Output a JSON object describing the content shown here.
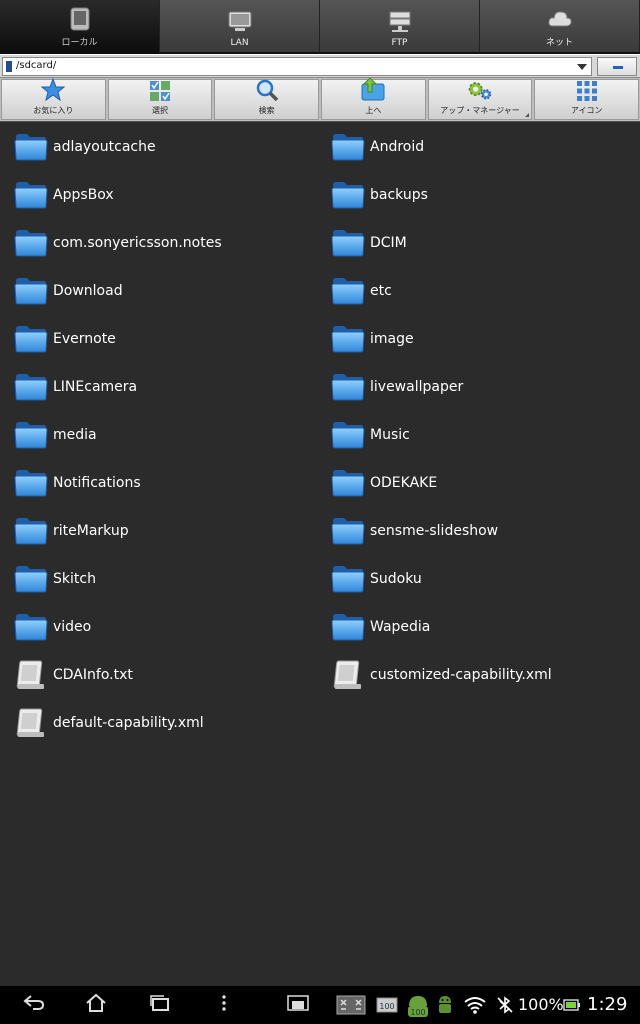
{
  "tabs": [
    {
      "label": "ローカル",
      "icon": "tablet-icon",
      "active": true
    },
    {
      "label": "LAN",
      "icon": "monitor-icon",
      "active": false
    },
    {
      "label": "FTP",
      "icon": "server-icon",
      "active": false
    },
    {
      "label": "ネット",
      "icon": "cloud-icon",
      "active": false
    }
  ],
  "path": {
    "value": "/sdcard/"
  },
  "toolbar": [
    {
      "label": "お気に入り",
      "icon": "star-icon"
    },
    {
      "label": "選択",
      "icon": "select-grid-icon"
    },
    {
      "label": "検索",
      "icon": "magnifier-icon"
    },
    {
      "label": "上へ",
      "icon": "up-folder-icon"
    },
    {
      "label": "アップ・マネージャー",
      "icon": "gears-icon"
    },
    {
      "label": "アイコン",
      "icon": "icon-grid-icon"
    }
  ],
  "files": [
    {
      "name": "adlayoutcache",
      "type": "folder"
    },
    {
      "name": "Android",
      "type": "folder"
    },
    {
      "name": "AppsBox",
      "type": "folder"
    },
    {
      "name": "backups",
      "type": "folder"
    },
    {
      "name": "com.sonyericsson.notes",
      "type": "folder"
    },
    {
      "name": "DCIM",
      "type": "folder"
    },
    {
      "name": "Download",
      "type": "folder"
    },
    {
      "name": "etc",
      "type": "folder"
    },
    {
      "name": "Evernote",
      "type": "folder"
    },
    {
      "name": "image",
      "type": "folder"
    },
    {
      "name": "LINEcamera",
      "type": "folder"
    },
    {
      "name": "livewallpaper",
      "type": "folder"
    },
    {
      "name": "media",
      "type": "folder"
    },
    {
      "name": "Music",
      "type": "folder"
    },
    {
      "name": "Notifications",
      "type": "folder"
    },
    {
      "name": "ODEKAKE",
      "type": "folder"
    },
    {
      "name": "riteMarkup",
      "type": "folder"
    },
    {
      "name": "sensme-slideshow",
      "type": "folder"
    },
    {
      "name": "Skitch",
      "type": "folder"
    },
    {
      "name": "Sudoku",
      "type": "folder"
    },
    {
      "name": "video",
      "type": "folder"
    },
    {
      "name": "Wapedia",
      "type": "folder"
    },
    {
      "name": "CDAInfo.txt",
      "type": "file"
    },
    {
      "name": "customized-capability.xml",
      "type": "file"
    },
    {
      "name": "default-capability.xml",
      "type": "file"
    }
  ],
  "status": {
    "battery_percent": "100%",
    "time": "1:29",
    "badge": "100"
  },
  "colors": {
    "folder": "#5aa8f0",
    "background": "#2b2b2b",
    "battery": "#7bd33a"
  }
}
